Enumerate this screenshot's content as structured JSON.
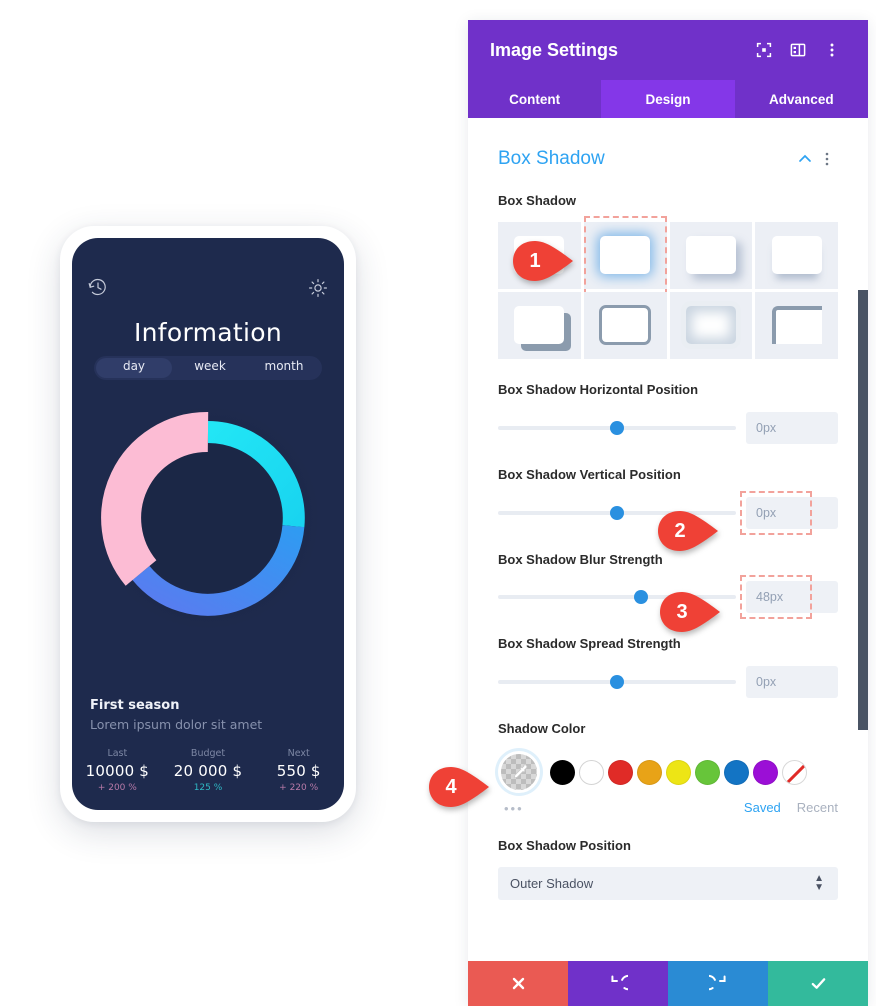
{
  "phone": {
    "title": "Information",
    "icons": {
      "history": "history-icon",
      "settings": "gear-icon"
    },
    "segments": [
      {
        "label": "day",
        "active": true
      },
      {
        "label": "week",
        "active": false
      },
      {
        "label": "month",
        "active": false
      }
    ],
    "donut": {
      "segments": [
        {
          "name": "cyan",
          "color": "#22E6F5",
          "percent": 25
        },
        {
          "name": "blue",
          "color": "#4B7BF5",
          "percent": 39
        },
        {
          "name": "pink",
          "color": "#FCBCD4",
          "percent": 33
        }
      ]
    },
    "footer": {
      "title": "First season",
      "subtitle": "Lorem ipsum dolor sit amet",
      "stats": [
        {
          "label": "Last",
          "value": "10000 $",
          "delta": "+ 200 %",
          "delta_color": "#b87aa8"
        },
        {
          "label": "Budget",
          "value": "20 000 $",
          "delta": "125 %",
          "delta_color": "#2fb8c4"
        },
        {
          "label": "Next",
          "value": "550 $",
          "delta": "+ 220 %",
          "delta_color": "#b87aa8"
        }
      ]
    }
  },
  "panel": {
    "header": {
      "title": "Image Settings",
      "icons": [
        {
          "name": "focus-icon",
          "label": "focus"
        },
        {
          "name": "layout-icon",
          "label": "layout"
        },
        {
          "name": "more-vertical-icon",
          "label": "more"
        }
      ]
    },
    "tabs": [
      {
        "label": "Content",
        "active": false
      },
      {
        "label": "Design",
        "active": true
      },
      {
        "label": "Advanced",
        "active": false
      }
    ],
    "section": {
      "title": "Box Shadow",
      "collapse_icon": "chevron-up-icon",
      "menu_icon": "more-vertical-icon"
    },
    "box_shadow": {
      "label": "Box Shadow",
      "presets": [
        {
          "id": "none",
          "selected": false
        },
        {
          "id": "glow",
          "selected": true
        },
        {
          "id": "offset-soft",
          "selected": false
        },
        {
          "id": "bottom-soft",
          "selected": false
        },
        {
          "id": "hard-offset",
          "selected": false
        },
        {
          "id": "outline",
          "selected": false
        },
        {
          "id": "inner-glow",
          "selected": false
        },
        {
          "id": "corner",
          "selected": false
        }
      ]
    },
    "fields": [
      {
        "label": "Box Shadow Horizontal Position",
        "value": "0px",
        "knob_pct": 50,
        "highlight": false
      },
      {
        "label": "Box Shadow Vertical Position",
        "value": "0px",
        "knob_pct": 50,
        "highlight": true
      },
      {
        "label": "Box Shadow Blur Strength",
        "value": "48px",
        "knob_pct": 60,
        "highlight": true
      },
      {
        "label": "Box Shadow Spread Strength",
        "value": "0px",
        "knob_pct": 50,
        "highlight": false
      }
    ],
    "shadow_color": {
      "label": "Shadow Color",
      "eyedropper": "eyedropper-icon",
      "swatches": [
        {
          "name": "black",
          "hex": "#000000"
        },
        {
          "name": "white",
          "hex": "#ffffff"
        },
        {
          "name": "red",
          "hex": "#E02B27"
        },
        {
          "name": "orange",
          "hex": "#E8A317"
        },
        {
          "name": "yellow",
          "hex": "#EDE515"
        },
        {
          "name": "green",
          "hex": "#67C53A"
        },
        {
          "name": "blue",
          "hex": "#1374C4"
        },
        {
          "name": "purple",
          "hex": "#9B0FD6"
        },
        {
          "name": "transparent",
          "hex": "none"
        }
      ],
      "more_dots": "•••",
      "saved_label": "Saved",
      "recent_label": "Recent"
    },
    "position": {
      "label": "Box Shadow Position",
      "value": "Outer Shadow"
    },
    "footer_buttons": [
      {
        "name": "cancel-button",
        "icon": "close-icon",
        "glyph": "✖",
        "color": "#ea5a53"
      },
      {
        "name": "undo-button",
        "icon": "undo-icon",
        "glyph": "↺",
        "color": "#7031c9"
      },
      {
        "name": "redo-button",
        "icon": "redo-icon",
        "glyph": "↻",
        "color": "#2a8bd4"
      },
      {
        "name": "save-button",
        "icon": "check-icon",
        "glyph": "✔",
        "color": "#33ba9c"
      }
    ]
  },
  "markers": [
    {
      "num": "1"
    },
    {
      "num": "2"
    },
    {
      "num": "3"
    },
    {
      "num": "4"
    }
  ],
  "colors": {
    "brand_purple": "#7031c9",
    "accent_blue": "#2ea3f2",
    "marker_red": "#ef4136"
  }
}
